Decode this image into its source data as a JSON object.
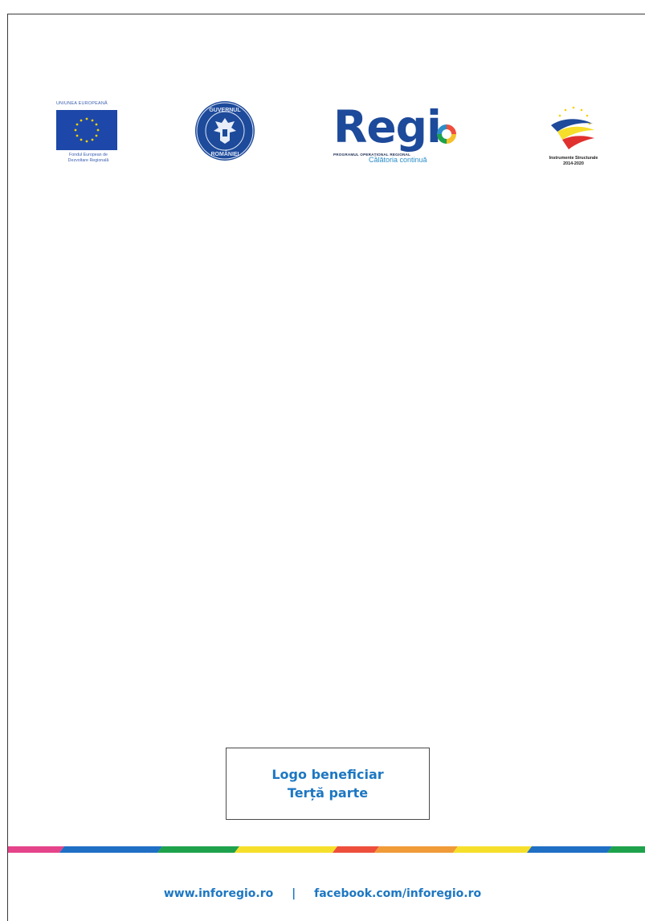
{
  "header": {
    "eu_logo": {
      "top_text": "UNIUNEA EUROPEANĂ",
      "bottom_text": "Fondul European de\nDezvoltare Regională",
      "flag_color": "#1d47a8",
      "star_color": "#f5d000"
    },
    "gov_logo": {
      "ring_text_top": "GUVERNUL",
      "ring_text_bottom": "ROMÂNIEI",
      "color": "#1d4a9a"
    },
    "regio_logo": {
      "word": "Regi",
      "program_text": "PROGRAMUL OPERAȚIONAL REGIONAL",
      "tagline": "Călătoria continuă",
      "brand_color": "#1d4a9a"
    },
    "is_logo": {
      "label": "Instrumente Structurale\n2014-2020"
    }
  },
  "beneficiary_box": {
    "line1": "Logo beneficiar",
    "line2": "Terță parte"
  },
  "footer": {
    "website": "www.inforegio.ro",
    "separator": "|",
    "facebook": "facebook.com/inforegio.ro",
    "text_color": "#1d77c2"
  },
  "color_band": [
    "#e5438a",
    "#1f6fc4",
    "#1ea24b",
    "#f6df2b",
    "#ee4f3c",
    "#f19a38",
    "#f6df2b",
    "#1f6fc4",
    "#1ea24b"
  ]
}
